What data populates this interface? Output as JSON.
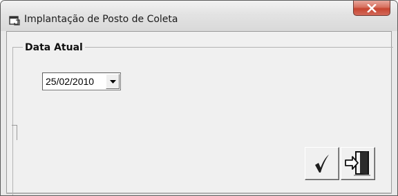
{
  "window": {
    "title": "Implantação de Posto de Coleta",
    "icon": "form-window-icon",
    "close_icon": "close-icon",
    "close_color": "#c74530"
  },
  "group": {
    "title": "Data Atual"
  },
  "date_field": {
    "value": "25/02/2010",
    "dropdown_icon": "chevron-down-icon"
  },
  "toolbar": {
    "confirm_icon": "checkmark-icon",
    "exit_icon": "exit-door-icon"
  }
}
